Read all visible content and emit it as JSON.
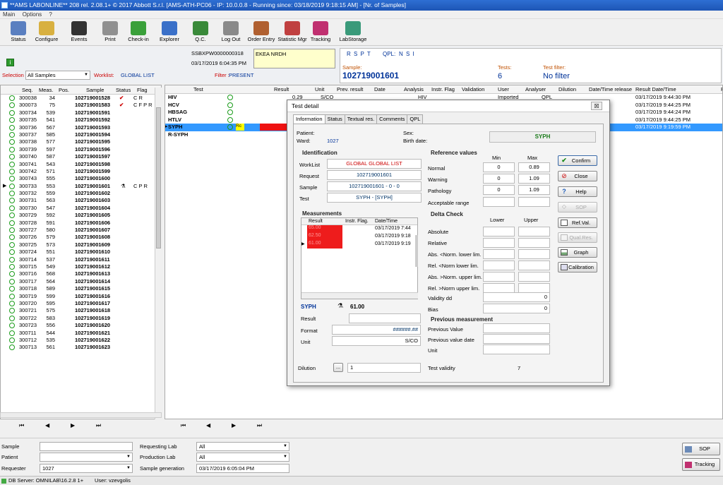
{
  "window": {
    "title": "**AMS LABONLINE** 208  rel. 2.08.1+   © 2017 Abbott S.r.l.   [AMS-ATH-PC06 - IP: 10.0.0.8  - Running since: 03/18/2019 9:18:15 AM]  -  [Nr. of Samples]"
  },
  "menu": {
    "items": [
      "Main",
      "Options",
      "?"
    ]
  },
  "toolbar": {
    "buttons": [
      {
        "label": "Status",
        "icon": "status-icon",
        "color": "#5a7fc0"
      },
      {
        "label": "Configure",
        "icon": "configure-icon",
        "color": "#d8b040"
      },
      {
        "label": "Events",
        "icon": "traffic-light-icon",
        "color": "#333333"
      },
      {
        "label": "Print",
        "icon": "printer-icon",
        "color": "#909090"
      },
      {
        "label": "Check-in",
        "icon": "check-in-icon",
        "color": "#3aa03a"
      },
      {
        "label": "Explorer",
        "icon": "explorer-icon",
        "color": "#3a70c8"
      },
      {
        "label": "Q.C.",
        "icon": "qc-chart-icon",
        "color": "#3a8a3a"
      },
      {
        "label": "Log Out",
        "icon": "lock-icon",
        "color": "#8a8a8a"
      },
      {
        "label": "Order Entry",
        "icon": "order-entry-icon",
        "color": "#b06030"
      },
      {
        "label": "Statistic Mgr",
        "icon": "statistic-icon",
        "color": "#c04040"
      },
      {
        "label": "Tracking",
        "icon": "tracking-icon",
        "color": "#c03070"
      },
      {
        "label": "LabStorage",
        "icon": "labstorage-icon",
        "color": "#3a9a7a"
      }
    ]
  },
  "header": {
    "barcode": "SSBXPW0000000318",
    "patient_name": "EKEA NRDH",
    "datetime": "03/17/2019 6:04:35 PM",
    "tests_flags": "R S P T",
    "qpl_label": "QPL:",
    "qpl_value": "N S I",
    "sample_label": "Sample:",
    "sample_value": "102719001601",
    "tests_label": "Tests:",
    "tests_value": "6",
    "filter_label": "Test filter:",
    "filter_value": "No filter",
    "info_icon": "info-icon"
  },
  "filters": {
    "selection_label": "Selection :",
    "selection_value": "All Samples",
    "worklist_label": "Worklist:",
    "worklist_value": "GLOBAL LIST",
    "filter_label": "Filter :",
    "filter_value": "PRESENT"
  },
  "sample_list": {
    "columns": [
      "Seq.",
      "Meas.",
      "Pos.",
      "Sample",
      "Status",
      "Flag"
    ],
    "rows": [
      {
        "seq": "300038",
        "meas": "34",
        "sample": "102719001528",
        "status": "✔",
        "flag": "C  R"
      },
      {
        "seq": "300073",
        "meas": "75",
        "sample": "102719001583",
        "status": "✔",
        "flag": "C F P  R"
      },
      {
        "seq": "300734",
        "meas": "539",
        "sample": "102719001591",
        "status": "",
        "flag": ""
      },
      {
        "seq": "300735",
        "meas": "541",
        "sample": "102719001592",
        "status": "",
        "flag": ""
      },
      {
        "seq": "300736",
        "meas": "567",
        "sample": "102719001593",
        "status": "",
        "flag": ""
      },
      {
        "seq": "300737",
        "meas": "585",
        "sample": "102719001594",
        "status": "",
        "flag": ""
      },
      {
        "seq": "300738",
        "meas": "577",
        "sample": "102719001595",
        "status": "",
        "flag": ""
      },
      {
        "seq": "300739",
        "meas": "597",
        "sample": "102719001596",
        "status": "",
        "flag": ""
      },
      {
        "seq": "300740",
        "meas": "587",
        "sample": "102719001597",
        "status": "",
        "flag": ""
      },
      {
        "seq": "300741",
        "meas": "543",
        "sample": "102719001598",
        "status": "",
        "flag": ""
      },
      {
        "seq": "300742",
        "meas": "571",
        "sample": "102719001599",
        "status": "",
        "flag": ""
      },
      {
        "seq": "300743",
        "meas": "555",
        "sample": "102719001600",
        "status": "",
        "flag": ""
      },
      {
        "seq": "300733",
        "meas": "553",
        "sample": "102719001601",
        "status": "",
        "flag": "C P  R",
        "selected": true
      },
      {
        "seq": "300732",
        "meas": "559",
        "sample": "102719001602",
        "status": "",
        "flag": ""
      },
      {
        "seq": "300731",
        "meas": "563",
        "sample": "102719001603",
        "status": "",
        "flag": ""
      },
      {
        "seq": "300730",
        "meas": "547",
        "sample": "102719001604",
        "status": "",
        "flag": ""
      },
      {
        "seq": "300729",
        "meas": "592",
        "sample": "102719001605",
        "status": "",
        "flag": ""
      },
      {
        "seq": "300728",
        "meas": "591",
        "sample": "102719001606",
        "status": "",
        "flag": ""
      },
      {
        "seq": "300727",
        "meas": "580",
        "sample": "102719001607",
        "status": "",
        "flag": ""
      },
      {
        "seq": "300726",
        "meas": "579",
        "sample": "102719001608",
        "status": "",
        "flag": ""
      },
      {
        "seq": "300725",
        "meas": "573",
        "sample": "102719001609",
        "status": "",
        "flag": ""
      },
      {
        "seq": "300724",
        "meas": "551",
        "sample": "102719001610",
        "status": "",
        "flag": ""
      },
      {
        "seq": "300714",
        "meas": "537",
        "sample": "102719001611",
        "status": "",
        "flag": ""
      },
      {
        "seq": "300715",
        "meas": "549",
        "sample": "102719001612",
        "status": "",
        "flag": ""
      },
      {
        "seq": "300716",
        "meas": "568",
        "sample": "102719001613",
        "status": "",
        "flag": ""
      },
      {
        "seq": "300717",
        "meas": "564",
        "sample": "102719001614",
        "status": "",
        "flag": ""
      },
      {
        "seq": "300718",
        "meas": "589",
        "sample": "102719001615",
        "status": "",
        "flag": ""
      },
      {
        "seq": "300719",
        "meas": "599",
        "sample": "102719001616",
        "status": "",
        "flag": ""
      },
      {
        "seq": "300720",
        "meas": "595",
        "sample": "102719001617",
        "status": "",
        "flag": ""
      },
      {
        "seq": "300721",
        "meas": "575",
        "sample": "102719001618",
        "status": "",
        "flag": ""
      },
      {
        "seq": "300722",
        "meas": "583",
        "sample": "102719001619",
        "status": "",
        "flag": ""
      },
      {
        "seq": "300723",
        "meas": "556",
        "sample": "102719001620",
        "status": "",
        "flag": ""
      },
      {
        "seq": "300711",
        "meas": "544",
        "sample": "102719001621",
        "status": "",
        "flag": ""
      },
      {
        "seq": "300712",
        "meas": "535",
        "sample": "102719001622",
        "status": "",
        "flag": ""
      },
      {
        "seq": "300713",
        "meas": "561",
        "sample": "102719001623",
        "status": "",
        "flag": ""
      }
    ]
  },
  "tests_table": {
    "columns": [
      "Test",
      "Result",
      "Unit",
      "Prev. result",
      "Date",
      "Analysis",
      "Instr. Flag",
      "Validation",
      "User",
      "Analyser",
      "Dilution",
      "Date/Time release",
      "Result Date/Time",
      "R"
    ],
    "rows": [
      {
        "test": "HIV",
        "result": "0.29",
        "unit": "S/CO",
        "analysis": "HIV",
        "user": "Imported",
        "analyser": "QPL",
        "rdt": "03/17/2019 9:44:30 PM"
      },
      {
        "test": "HCV",
        "result": "",
        "unit": "",
        "analysis": "",
        "user": "",
        "analyser": "",
        "rdt": "03/17/2019 9:44:25 PM"
      },
      {
        "test": "HBSAG",
        "result": "",
        "unit": "",
        "analysis": "",
        "user": "",
        "analyser": "",
        "rdt": "03/17/2019 9:44:24 PM"
      },
      {
        "test": "HTLV",
        "result": "",
        "unit": "",
        "analysis": "",
        "user": "",
        "analyser": "",
        "rdt": "03/17/2019 9:44:25 PM"
      },
      {
        "test": "SYPH",
        "result": "",
        "unit": "",
        "analysis": "",
        "user": "",
        "analyser": "",
        "rdt": "03/17/2019 9:19:59 PM",
        "selected": true,
        "badge": "Rc"
      },
      {
        "test": "R-SYPH",
        "result": "",
        "unit": "",
        "analysis": "",
        "user": "",
        "analyser": "",
        "rdt": ""
      }
    ]
  },
  "nav": {
    "first": "⏮",
    "prev": "◀",
    "next": "▶",
    "last": "⏭"
  },
  "dialog": {
    "title": "Test detail",
    "close": "☒",
    "tabs": [
      "Information",
      "Status",
      "Textual res.",
      "Comments",
      "QPL"
    ],
    "patient_label": "Patient:",
    "ward_label": "Ward:",
    "ward_value": "1027",
    "sex_label": "Sex:",
    "birth_label": "Birth date:",
    "test_name": "SYPH",
    "identification": {
      "title": "Identification",
      "worklist_label": "WorkList",
      "worklist_value": "GLOBAL  GLOBAL LIST",
      "request_label": "Request",
      "request_value": "102719001601",
      "sample_label": "Sample",
      "sample_value": "102719001601 - 0 - 0",
      "test_label": "Test",
      "test_value": "SYPH - [SYPH]"
    },
    "reference": {
      "title": "Reference values",
      "min": "Min",
      "max": "Max",
      "normal_label": "Normal",
      "normal_min": "0",
      "normal_max": "0.89",
      "warning_label": "Warning",
      "warning_min": "0",
      "warning_max": "1.09",
      "pathology_label": "Pathology",
      "pathology_min": "0",
      "pathology_max": "1.09",
      "acceptable_label": "Acceptable range"
    },
    "measurements": {
      "title": "Measurements",
      "columns": [
        "Result",
        "Instr. Flag.",
        "Date/Time"
      ],
      "rows": [
        {
          "result": "65.00",
          "dt": "03/17/2019 7:44"
        },
        {
          "result": "62.50",
          "dt": "03/17/2019 9:18"
        },
        {
          "result": "61.00",
          "dt": "03/17/2019 9:19"
        }
      ]
    },
    "delta": {
      "title": "Delta Check",
      "lower": "Lower",
      "upper": "Upper",
      "rows": [
        "Absolute",
        "Relative",
        "Abs. <Norm. lower lim.",
        "Rel. <Norm lower lim.",
        "Abs. >Norm. upper lim.",
        "Rel. >Norm upper lim."
      ],
      "validity_label": "Validity dd",
      "validity_value": "0",
      "bias_label": "Bias",
      "bias_value": "0"
    },
    "result_panel": {
      "test": "SYPH",
      "value": "61.00",
      "result_label": "Result",
      "format_label": "Format",
      "format_value": "######.##",
      "unit_label": "Unit",
      "unit_value": "S/CO"
    },
    "previous": {
      "title": "Previous measurement",
      "value_label": "Previous Value",
      "date_label": "Previous value date",
      "unit_label": "Unit"
    },
    "dilution_label": "Dilution",
    "dilution_btn": "...",
    "dilution_value": "1",
    "validity_label": "Test validity",
    "validity_value": "7",
    "buttons": {
      "confirm": "Confirm",
      "close": "Close",
      "help": "Help",
      "sop": "SOP",
      "refval": "Ref.Val.",
      "qualres": "Qual.Res.",
      "graph": "Graph",
      "calibration": "Calibration"
    }
  },
  "bottom": {
    "sample_label": "Sample",
    "patient_label": "Patient",
    "requester_label": "Requester",
    "requester_value": "1027",
    "req_lab_label": "Requesting Lab",
    "req_lab_value": "All",
    "prod_lab_label": "Production Lab",
    "prod_lab_value": "All",
    "sample_gen_label": "Sample generation",
    "sample_gen_value": "03/17/2019 6:05:04 PM",
    "sop_btn": "SOP",
    "tracking_btn": "Tracking"
  },
  "statusbar": {
    "db": "DB Server: OMNILAB\\16.2.8 1+",
    "user": "User: vzevgolis"
  }
}
